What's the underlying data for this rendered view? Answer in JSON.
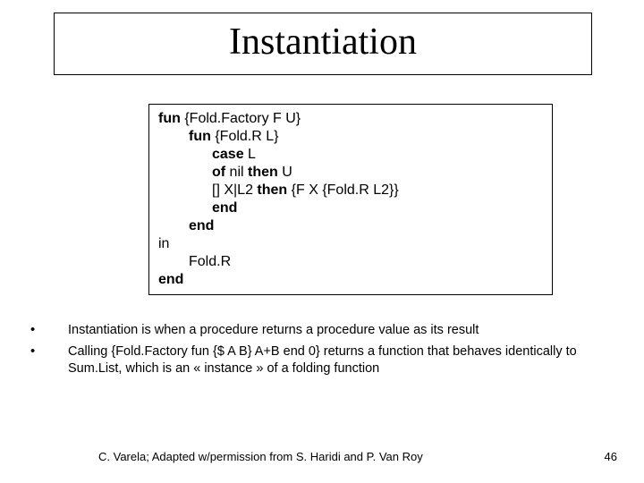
{
  "title": "Instantiation",
  "code": {
    "l1_kw": "fun",
    "l1_rest": " {Fold.Factory F U}",
    "l2_kw": "fun",
    "l2_rest": " {Fold.R L}",
    "l3_kw": "case",
    "l3_rest": " L",
    "l4_kw1": "of",
    "l4_mid": " nil ",
    "l4_kw2": "then",
    "l4_rest": " U",
    "l5_pre": "[]  X|L2 ",
    "l5_kw": "then",
    "l5_rest": " {F X  {Fold.R L2}}",
    "l6_kw": "end",
    "l7_kw": "end",
    "l8": "in",
    "l9": "Fold.R",
    "l10_kw": "end"
  },
  "bullets": {
    "b1": "Instantiation is when a procedure returns a procedure value as its result",
    "b2_pre": "Calling {",
    "b2_tok1": "Fold.Factory fun",
    "b2_mid1": " {$ A B} A+B ",
    "b2_tok2": "end",
    "b2_mid2": " 0",
    "b2_post1": "} returns a function that behaves identically to ",
    "b2_tok3": "Sum.List",
    "b2_post2": ", which is an « instance » of a folding function"
  },
  "footer": {
    "credit": "C. Varela; Adapted w/permission from S. Haridi and P. Van Roy",
    "page": "46"
  }
}
